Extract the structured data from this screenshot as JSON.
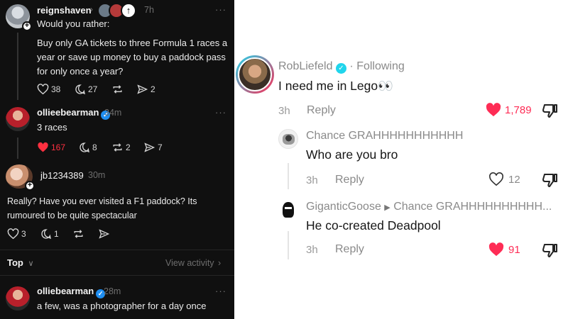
{
  "left": {
    "post1": {
      "username": "reignshaven",
      "time": "7h",
      "more": "···",
      "title": "Would you rather:",
      "body": "Buy only GA tickets to three Formula 1 races a year or save up money to buy a paddock pass for only once a year?",
      "likes": "38",
      "replies": "27",
      "shares": "2"
    },
    "post2": {
      "username": "ollieebearman",
      "time": "34m",
      "more": "···",
      "body": "3 races",
      "likes": "167",
      "replies": "8",
      "reposts": "2",
      "shares": "7"
    },
    "post3": {
      "username": "jb1234389",
      "time": "30m",
      "body": "Really? Have you ever visited a F1 paddock? Its rumoured to be quite spectacular",
      "likes": "3",
      "replies": "1"
    },
    "section": {
      "sort_label": "Top",
      "activity_link": "View activity"
    },
    "post4": {
      "username": "olliebearman",
      "time": "28m",
      "more": "···",
      "body": "a few, was a photographer for a day once"
    }
  },
  "right": {
    "comment1": {
      "username": "RobLiefeld",
      "separator": "·",
      "following": "Following",
      "text": "I need me in Lego👀",
      "time": "3h",
      "reply": "Reply",
      "likes": "1,789"
    },
    "comment2": {
      "username": "Chance GRAHHHHHHHHHHH",
      "text": "Who are you bro",
      "time": "3h",
      "reply": "Reply",
      "likes": "12"
    },
    "comment3": {
      "username": "GiganticGoose",
      "reply_to": "Chance GRAHHHHHHHHHH...",
      "text": "He co-created Deadpool",
      "time": "3h",
      "reply": "Reply",
      "likes": "91"
    }
  },
  "colors": {
    "dark_bg": "#101010",
    "like_red": "#ff3040",
    "verified_blue": "#1f8ef1",
    "tiktok_red": "#fe2c55",
    "tiktok_teal": "#20d5ec"
  }
}
